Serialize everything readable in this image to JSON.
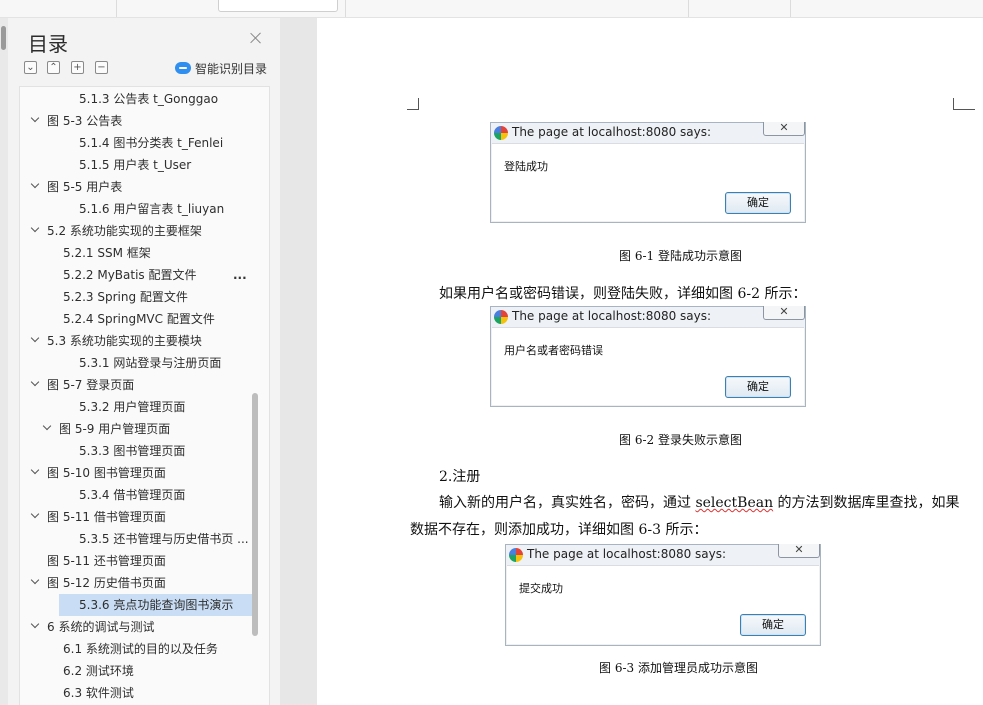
{
  "toc_panel": {
    "title": "目录",
    "smart_label": "智能识别目录",
    "tool_buttons": [
      "⌄",
      "⌃",
      "+",
      "−"
    ],
    "more": "...",
    "items": [
      {
        "label": "5.1.3 公告表 t_Gonggao",
        "expandable": false,
        "selected": false
      },
      {
        "label": "图 5-3 公告表",
        "expandable": true,
        "selected": false
      },
      {
        "label": "5.1.4 图书分类表 t_Fenlei",
        "expandable": false,
        "selected": false
      },
      {
        "label": "5.1.5 用户表 t_User",
        "expandable": false,
        "selected": false
      },
      {
        "label": "图 5-5 用户表",
        "expandable": true,
        "selected": false
      },
      {
        "label": "5.1.6 用户留言表 t_liuyan",
        "expandable": false,
        "selected": false
      },
      {
        "label": "5.2 系统功能实现的主要框架",
        "expandable": true,
        "selected": false
      },
      {
        "label": "5.2.1 SSM 框架",
        "expandable": false,
        "selected": false
      },
      {
        "label": "5.2.2 MyBatis 配置文件",
        "expandable": false,
        "selected": false
      },
      {
        "label": "5.2.3 Spring 配置文件",
        "expandable": false,
        "selected": false
      },
      {
        "label": "5.2.4 SpringMVC 配置文件",
        "expandable": false,
        "selected": false
      },
      {
        "label": "5.3 系统功能实现的主要模块",
        "expandable": true,
        "selected": false
      },
      {
        "label": "5.3.1 网站登录与注册页面",
        "expandable": false,
        "selected": false
      },
      {
        "label": "图 5-7 登录页面",
        "expandable": true,
        "selected": false
      },
      {
        "label": "5.3.2 用户管理页面",
        "expandable": false,
        "selected": false
      },
      {
        "label": "图 5-9 用户管理页面",
        "expandable": true,
        "selected": false
      },
      {
        "label": "5.3.3 图书管理页面",
        "expandable": false,
        "selected": false
      },
      {
        "label": "图 5-10 图书管理页面",
        "expandable": true,
        "selected": false
      },
      {
        "label": "5.3.4 借书管理页面",
        "expandable": false,
        "selected": false
      },
      {
        "label": "图 5-11 借书管理页面",
        "expandable": true,
        "selected": false
      },
      {
        "label": "5.3.5 还书管理与历史借书页 ...",
        "expandable": false,
        "selected": false
      },
      {
        "label": "图 5-11 还书管理页面",
        "expandable": false,
        "selected": false
      },
      {
        "label": "图 5-12 历史借书页面",
        "expandable": true,
        "selected": false
      },
      {
        "label": "5.3.6 亮点功能查询图书演示",
        "expandable": false,
        "selected": true
      },
      {
        "label": "6 系统的调试与测试",
        "expandable": true,
        "selected": false
      },
      {
        "label": "6.1 系统测试的目的以及任务",
        "expandable": false,
        "selected": false
      },
      {
        "label": "6.2 测试环境",
        "expandable": false,
        "selected": false
      },
      {
        "label": "6.3 软件测试",
        "expandable": false,
        "selected": false
      }
    ]
  },
  "document": {
    "dialogs": [
      {
        "title": "The page at localhost:8080 says:",
        "message": "登陆成功",
        "ok": "确定",
        "close": "✕"
      },
      {
        "title": "The page at localhost:8080 says:",
        "message": "用户名或者密码错误",
        "ok": "确定",
        "close": "✕"
      },
      {
        "title": "The page at localhost:8080 says:",
        "message": "提交成功",
        "ok": "确定",
        "close": "✕"
      }
    ],
    "captions": [
      "图 6-1  登陆成功示意图",
      "图 6-2  登录失败示意图",
      "图 6-3  添加管理员成功示意图"
    ],
    "para1": "如果用户名或密码错误，则登陆失败，详细如图 6-2 所示：",
    "heading2": "2.注册",
    "para2_start": "输入新的用户名，真实姓名，密码，通过 ",
    "para2_code": "selectBean",
    "para2_end": " 的方法到数据库里查找，如果",
    "para2_line2": "数据不存在，则添加成功，详细如图 6-3 所示："
  }
}
